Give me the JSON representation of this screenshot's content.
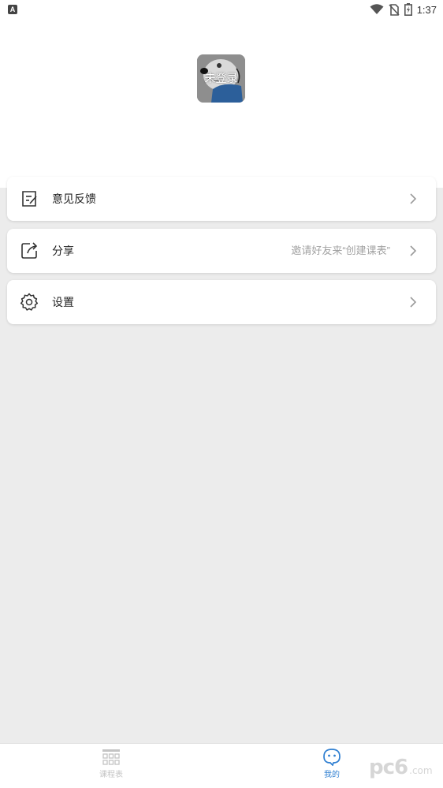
{
  "status_bar": {
    "app_indicator": "A",
    "time": "1:37",
    "icons": [
      "wifi-icon",
      "no-sim-icon",
      "battery-charging-icon"
    ]
  },
  "profile": {
    "avatar_label": "未登录",
    "avatar_icon": "cartoon-avatar-image"
  },
  "menu": [
    {
      "label": "意见反馈",
      "hint": "",
      "icon": "feedback-icon"
    },
    {
      "label": "分享",
      "hint": "邀请好友来“创建课表”",
      "icon": "share-icon"
    },
    {
      "label": "设置",
      "hint": "",
      "icon": "gear-icon"
    }
  ],
  "bottom_nav": {
    "tabs": [
      {
        "label": "课程表",
        "icon": "grid-icon",
        "active": false
      },
      {
        "label": "我的",
        "icon": "chat-face-icon",
        "active": true
      }
    ],
    "active_color": "#2f7fd1",
    "inactive_color": "#c4c4c4"
  },
  "watermark": {
    "big": "pc6",
    "small": ".com"
  }
}
